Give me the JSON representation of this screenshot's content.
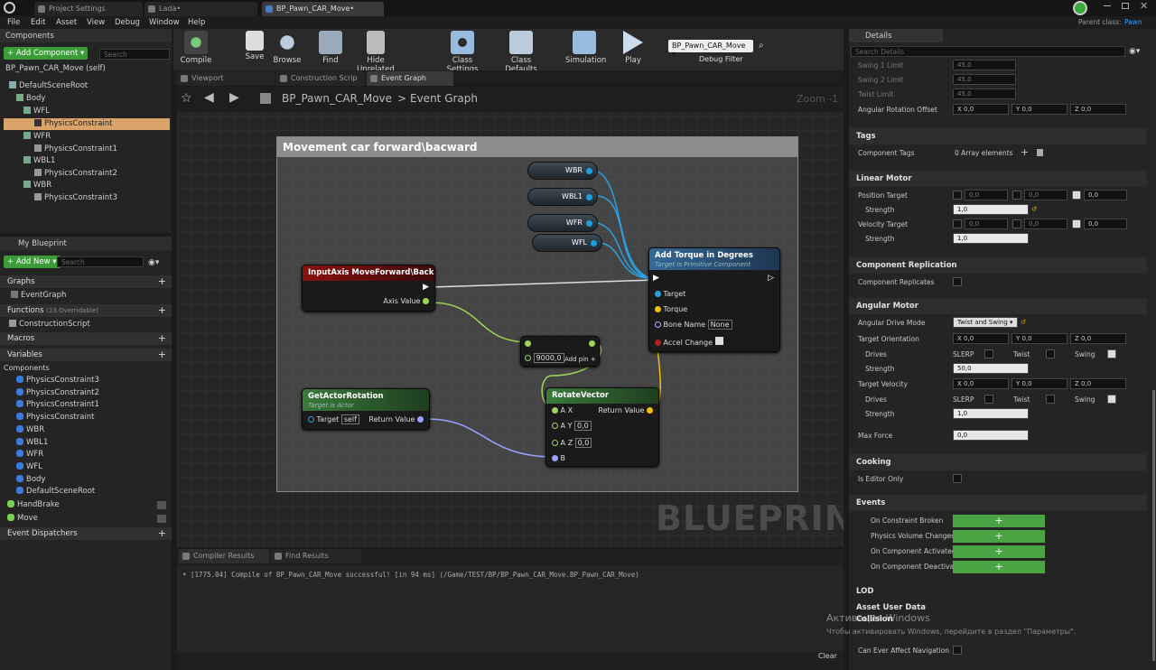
{
  "window": {
    "tabs": [
      "Project Settings",
      "Lada•",
      "BP_Pawn_CAR_Move•"
    ],
    "parent_class_label": "Parent class:",
    "parent_class_value": "Pawn"
  },
  "menu": [
    "File",
    "Edit",
    "Asset",
    "View",
    "Debug",
    "Window",
    "Help"
  ],
  "components": {
    "title": "Components",
    "add_label": "+ Add Component ▾",
    "search_placeholder": "Search",
    "self_label": "BP_Pawn_CAR_Move (self)",
    "tree": [
      "DefaultSceneRoot",
      "Body",
      "WFL",
      "PhysicsConstraint",
      "WFR",
      "PhysicsConstraint1",
      "WBL1",
      "PhysicsConstraint2",
      "WBR",
      "PhysicsConstraint3"
    ]
  },
  "my_blueprint": {
    "title": "My Blueprint",
    "add_label": "+ Add New ▾",
    "search_placeholder": "Search",
    "graphs_label": "Graphs",
    "event_graph": "EventGraph",
    "functions_label": "Functions",
    "functions_note": "(23 Overridable)",
    "construction_script": "ConstructionScript",
    "macros_label": "Macros",
    "variables_label": "Variables",
    "components_label": "Components",
    "variables": [
      "PhysicsConstraint3",
      "PhysicsConstraint2",
      "PhysicsConstraint1",
      "PhysicsConstraint",
      "WBR",
      "WBL1",
      "WFR",
      "WFL",
      "Body",
      "DefaultSceneRoot"
    ],
    "extra_vars": [
      "HandBrake",
      "Move"
    ],
    "dispatchers_label": "Event Dispatchers"
  },
  "toolbar": [
    "Compile",
    "Save",
    "Browse",
    "Find",
    "Hide Unrelated",
    "Class Settings",
    "Class Defaults",
    "Simulation",
    "Play"
  ],
  "debug_filter": {
    "value": "BP_Pawn_CAR_Move ▾",
    "label": "Debug Filter"
  },
  "editor_tabs": [
    "Viewport",
    "Construction Scrip",
    "Event Graph"
  ],
  "breadcrumb": {
    "root": "BP_Pawn_CAR_Move",
    "sep": ">",
    "current": "Event Graph",
    "zoom": "Zoom -1"
  },
  "graph": {
    "comment": "Movement car forward\\bacward",
    "vars": [
      "WBR",
      "WBL1",
      "WFR",
      "WFL"
    ],
    "input_node": {
      "title": "InputAxis MoveForward\\Back",
      "pin": "Axis Value"
    },
    "torque_node": {
      "title": "Add Torque in Degrees",
      "sub": "Target is Primitive Component",
      "pins": [
        "Target",
        "Torque",
        "Bone Name",
        "Accel Change"
      ],
      "bone_value": "None"
    },
    "mult_node": {
      "value": "9000,0",
      "add_pin": "Add pin"
    },
    "rotation_node": {
      "title": "GetActorRotation",
      "sub": "Target is Actor",
      "target": "Target",
      "self": "self",
      "ret": "Return Value"
    },
    "rotate_node": {
      "title": "RotateVector",
      "pins": [
        "A X",
        "A Y",
        "A Z",
        "B"
      ],
      "ay": "0,0",
      "az": "0,0",
      "ret": "Return Value"
    },
    "watermark": "BLUEPRINT"
  },
  "output": {
    "tabs": [
      "Compiler Results",
      "Find Results"
    ],
    "log": "• [1775.04] Compile of BP_Pawn_CAR_Move successful! [in 94 ms] (/Game/TEST/BP/BP_Pawn_CAR_Move.BP_Pawn_CAR_Move)",
    "clear": "Clear"
  },
  "details": {
    "title": "Details",
    "search_placeholder": "Search Details",
    "limits": [
      {
        "label": "Swing 1 Limit",
        "value": "45,0"
      },
      {
        "label": "Swing 2 Limit",
        "value": "45,0"
      },
      {
        "label": "Twist Limit",
        "value": "45,0"
      }
    ],
    "ang_offset": {
      "label": "Angular Rotation Offset",
      "x": "X 0,0",
      "y": "Y 0,0",
      "z": "Z 0,0"
    },
    "tags": {
      "title": "Tags",
      "label": "Component Tags",
      "value": "0 Array elements"
    },
    "linear": {
      "title": "Linear Motor",
      "pos": "Position Target",
      "vel": "Velocity Target",
      "strength": "Strength",
      "s1": "1,0",
      "s2": "1,0",
      "zero": "0,0"
    },
    "replication": {
      "title": "Component Replication",
      "label": "Component Replicates"
    },
    "angular": {
      "title": "Angular Motor",
      "mode_label": "Angular Drive Mode",
      "mode_value": "Twist and Swing ▾",
      "orient": "Target Orientation",
      "drives": "Drives",
      "slerp": "SLERP",
      "twist": "Twist",
      "swing": "Swing",
      "strength": "Strength",
      "s1": "50,0",
      "velocity": "Target Velocity",
      "s2": "1,0",
      "max_force": "Max Force",
      "max_val": "0,0",
      "x": "X 0,0",
      "y": "Y 0,0",
      "z": "Z 0,0"
    },
    "cooking": {
      "title": "Cooking",
      "label": "Is Editor Only"
    },
    "events": {
      "title": "Events",
      "items": [
        "On Constraint Broken",
        "Physics Volume Changed",
        "On Component Activated",
        "On Component Deactivat"
      ]
    },
    "lod": "LOD",
    "asset_user": "Asset User Data",
    "collision": "Collision",
    "nav": "Can Ever Affect Navigation",
    "activate_title": "Активация Windows",
    "activate_text": "Чтобы активировать Windows, перейдите в раздел \"Параметры\"."
  }
}
